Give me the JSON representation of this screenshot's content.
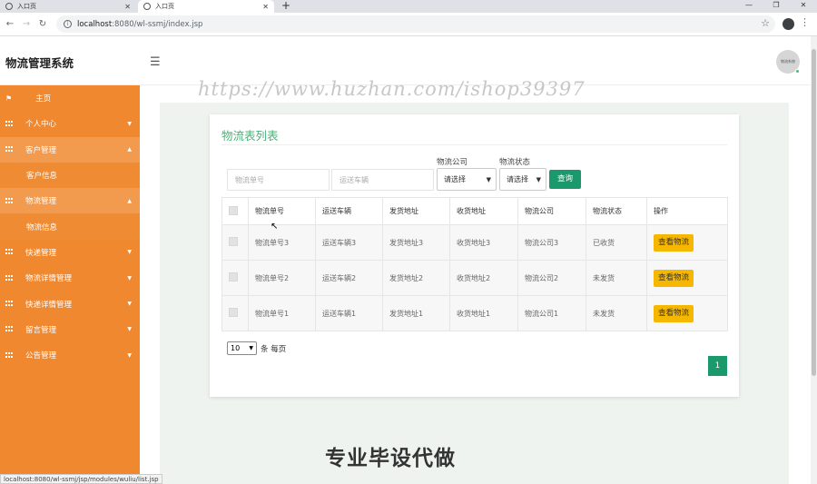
{
  "browser": {
    "tabs": [
      {
        "label": "入口页"
      },
      {
        "label": "入口页"
      }
    ],
    "url_host": "localhost",
    "url_path": ":8080/wl-ssmj/index.jsp",
    "status_url": "localhost:8080/wl-ssmj/jsp/modules/wuliu/list.jsp"
  },
  "app": {
    "title": "物流管理系统",
    "avatar_text": "物流系统"
  },
  "watermark": {
    "top": "https://www.huzhan.com/ishop39397",
    "bottom": "专业毕设代做"
  },
  "sidebar": {
    "items": [
      {
        "label": "主页"
      },
      {
        "label": "个人中心"
      },
      {
        "label": "客户管理"
      },
      {
        "label": "客户信息"
      },
      {
        "label": "物流管理"
      },
      {
        "label": "物流信息"
      },
      {
        "label": "快递管理"
      },
      {
        "label": "物流详情管理"
      },
      {
        "label": "快递详情管理"
      },
      {
        "label": "留言管理"
      },
      {
        "label": "公告管理"
      }
    ]
  },
  "page": {
    "title": "物流表列表",
    "search": {
      "order_placeholder": "物流单号",
      "vehicle_placeholder": "运送车辆",
      "company_label": "物流公司",
      "company_value": "请选择",
      "status_label": "物流状态",
      "status_value": "请选择",
      "query_button": "查询"
    },
    "table": {
      "headers": [
        "物流单号",
        "运送车辆",
        "发货地址",
        "收货地址",
        "物流公司",
        "物流状态",
        "操作"
      ],
      "rows": [
        {
          "order": "物流单号3",
          "vehicle": "运送车辆3",
          "from": "发货地址3",
          "to": "收货地址3",
          "company": "物流公司3",
          "status": "已收货",
          "action": "查看物流"
        },
        {
          "order": "物流单号2",
          "vehicle": "运送车辆2",
          "from": "发货地址2",
          "to": "收货地址2",
          "company": "物流公司2",
          "status": "未发货",
          "action": "查看物流"
        },
        {
          "order": "物流单号1",
          "vehicle": "运送车辆1",
          "from": "发货地址1",
          "to": "收货地址1",
          "company": "物流公司1",
          "status": "未发货",
          "action": "查看物流"
        }
      ]
    },
    "pager": {
      "page_size": "10",
      "suffix": "条 每页",
      "current_page": "1"
    }
  },
  "colors": {
    "sidebar": "#f0882f",
    "accent_green": "#1a9a6c",
    "title_green": "#4caf7a",
    "view_button": "#f6b700"
  }
}
